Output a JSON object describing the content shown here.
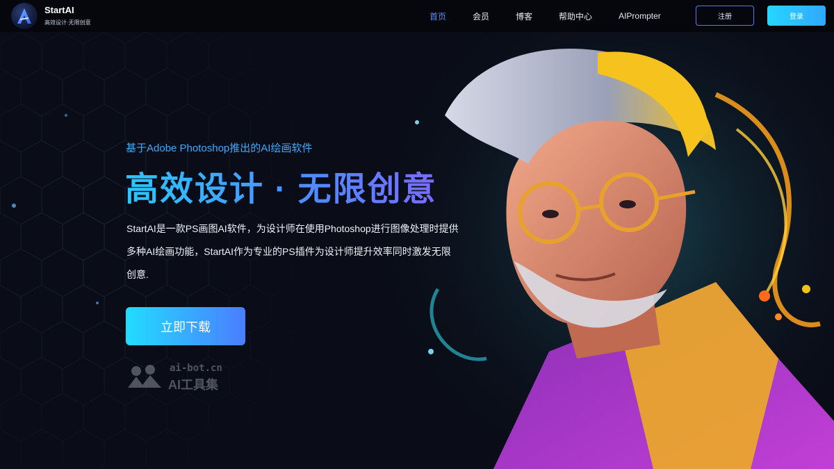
{
  "header": {
    "app_name": "StartAI",
    "tagline": "高效设计·无限创意",
    "nav": [
      {
        "label": "首页",
        "active": true
      },
      {
        "label": "会员",
        "active": false
      },
      {
        "label": "博客",
        "active": false
      },
      {
        "label": "帮助中心",
        "active": false
      },
      {
        "label": "AIPrompter",
        "active": false
      }
    ],
    "register_label": "注册",
    "login_label": "登录"
  },
  "hero": {
    "subtitle": "基于Adobe Photoshop推出的AI绘画软件",
    "title": "高效设计 · 无限创意",
    "description": "StartAI是一款PS画图AI软件，为设计师在使用Photoshop进行图像处理时提供多种AI绘画功能，StartAI作为专业的PS插件为设计师提升效率同时激发无限创意.",
    "download_label": "立即下载",
    "artwork_icon": "portrait-illustration"
  },
  "watermark": {
    "url": "ai-bot.cn",
    "name": "AI工具集"
  },
  "colors": {
    "accent": "#3fa9ff",
    "nav_active": "#5a8cff",
    "background": "#0a0d18"
  }
}
